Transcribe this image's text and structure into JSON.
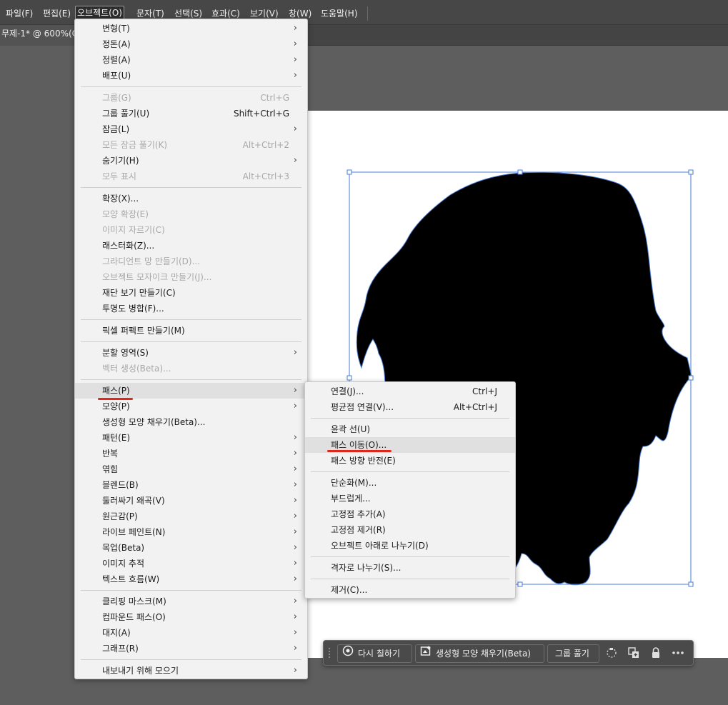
{
  "menubar": {
    "items": [
      "파일(F)",
      "편집(E)",
      "오브젝트(O)",
      "문자(T)",
      "선택(S)",
      "효과(C)",
      "보기(V)",
      "창(W)",
      "도움말(H)"
    ]
  },
  "document": {
    "tab_title": "무제-1* @ 600%(C"
  },
  "object_menu": {
    "items": [
      {
        "label": "변형(T)",
        "submenu": true
      },
      {
        "label": "정돈(A)",
        "submenu": true
      },
      {
        "label": "정렬(A)",
        "submenu": true
      },
      {
        "label": "배포(U)",
        "submenu": true
      },
      {
        "sep": true
      },
      {
        "label": "그룹(G)",
        "shortcut": "Ctrl+G",
        "disabled": true
      },
      {
        "label": "그룹 풀기(U)",
        "shortcut": "Shift+Ctrl+G"
      },
      {
        "label": "잠금(L)",
        "submenu": true
      },
      {
        "label": "모든 잠금 풀기(K)",
        "shortcut": "Alt+Ctrl+2",
        "disabled": true
      },
      {
        "label": "숨기기(H)",
        "submenu": true
      },
      {
        "label": "모두 표시",
        "shortcut": "Alt+Ctrl+3",
        "disabled": true
      },
      {
        "sep": true
      },
      {
        "label": "확장(X)..."
      },
      {
        "label": "모양 확장(E)",
        "disabled": true
      },
      {
        "label": "이미지 자르기(C)",
        "disabled": true
      },
      {
        "label": "래스터화(Z)..."
      },
      {
        "label": "그라디언트 망 만들기(D)...",
        "disabled": true
      },
      {
        "label": "오브젝트 모자이크 만들기(J)...",
        "disabled": true
      },
      {
        "label": "재단 보기 만들기(C)"
      },
      {
        "label": "투명도 병합(F)..."
      },
      {
        "sep": true
      },
      {
        "label": "픽셀 퍼펙트 만들기(M)"
      },
      {
        "sep": true
      },
      {
        "label": "분할 영역(S)",
        "submenu": true
      },
      {
        "label": "벡터 생성(Beta)...",
        "disabled": true
      },
      {
        "sep": true
      },
      {
        "label": "패스(P)",
        "submenu": true,
        "highlighted": true
      },
      {
        "label": "모양(P)",
        "submenu": true
      },
      {
        "label": "생성형 모양 채우기(Beta)..."
      },
      {
        "label": "패턴(E)",
        "submenu": true
      },
      {
        "label": "반복",
        "submenu": true
      },
      {
        "label": "엮힘",
        "submenu": true
      },
      {
        "label": "블렌드(B)",
        "submenu": true
      },
      {
        "label": "둘러싸기 왜곡(V)",
        "submenu": true
      },
      {
        "label": "원근감(P)",
        "submenu": true
      },
      {
        "label": "라이브 페인트(N)",
        "submenu": true
      },
      {
        "label": "목업(Beta)",
        "submenu": true
      },
      {
        "label": "이미지 추적",
        "submenu": true
      },
      {
        "label": "텍스트 흐름(W)",
        "submenu": true
      },
      {
        "sep": true
      },
      {
        "label": "클리핑 마스크(M)",
        "submenu": true
      },
      {
        "label": "컴파운드 패스(O)",
        "submenu": true
      },
      {
        "label": "대지(A)",
        "submenu": true
      },
      {
        "label": "그래프(R)",
        "submenu": true
      },
      {
        "sep": true
      },
      {
        "label": "내보내기 위해 모으기",
        "submenu": true
      }
    ]
  },
  "path_menu": {
    "items": [
      {
        "label": "연결(J)...",
        "shortcut": "Ctrl+J"
      },
      {
        "label": "평균점 연결(V)...",
        "shortcut": "Alt+Ctrl+J"
      },
      {
        "sep": true
      },
      {
        "label": "윤곽 선(U)"
      },
      {
        "label": "패스 이동(O)...",
        "highlighted": true
      },
      {
        "label": "패스 방향 반전(E)"
      },
      {
        "sep": true
      },
      {
        "label": "단순화(M)..."
      },
      {
        "label": "부드럽게..."
      },
      {
        "label": "고정점 추가(A)"
      },
      {
        "label": "고정점 제거(R)"
      },
      {
        "label": "오브젝트 아래로 나누기(D)"
      },
      {
        "sep": true
      },
      {
        "label": "격자로 나누기(S)..."
      },
      {
        "sep": true
      },
      {
        "label": "제거(C)..."
      }
    ]
  },
  "taskbar": {
    "recolor_label": "다시 칠하기",
    "genfill_label": "생성형 모양 채우기(Beta)",
    "ungroup_label": "그룹 풀기",
    "icons": [
      "transform-icon",
      "duplicate-icon",
      "lock-icon",
      "more-icon"
    ]
  },
  "colors": {
    "selection": "#4a7ed8",
    "highlight_underline": "#e0281a",
    "menu_bg": "#f2f2f2"
  }
}
